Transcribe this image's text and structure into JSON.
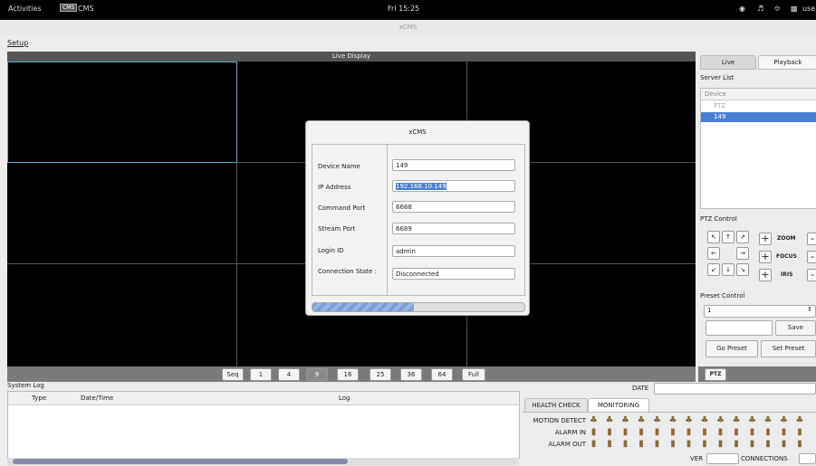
{
  "topbar": {
    "activities": "Activities",
    "app_icon": "CMS",
    "app_name": "CMS",
    "clock": "Fri 15:25",
    "user": "use"
  },
  "window": {
    "title": "xCMS"
  },
  "menu": {
    "setup": "Setup"
  },
  "live": {
    "header": "Live Display",
    "layout_buttons": [
      "Seq",
      "1",
      "4",
      "9",
      "16",
      "25",
      "36",
      "64",
      "Full"
    ],
    "selected_layout": "9"
  },
  "right_panel": {
    "tabs": {
      "live": "Live",
      "playback": "Playback"
    },
    "server_list_label": "Server List",
    "device_header": "Device",
    "devices": [
      "PTZ",
      "149"
    ],
    "selected_device": "149",
    "ptz_control_label": "PTZ Control",
    "ptz_arrows": [
      "↖",
      "↑",
      "↗",
      "←",
      "",
      "→",
      "↙",
      "↓",
      "↘"
    ],
    "ptz_params": [
      {
        "label": "ZOOM"
      },
      {
        "label": "FOCUS"
      },
      {
        "label": "IRIS"
      }
    ],
    "preset_control_label": "Preset Control",
    "preset_value": "1",
    "preset_name_value": "",
    "save": "Save",
    "go_preset": "Go Preset",
    "set_preset": "Set Preset",
    "ptz_button": "PTZ"
  },
  "system_log": {
    "title": "System Log",
    "columns": [
      "Type",
      "Date/Time",
      "Log"
    ]
  },
  "monitor": {
    "date_label": "DATE",
    "tabs": [
      "HEALTH CHECK",
      "MONITORING"
    ],
    "active_tab": "MONITORING",
    "rows": [
      "MOTION DETECT",
      "ALARM IN",
      "ALARM OUT"
    ],
    "ver_label": "VER",
    "connections_label": "CONNECTIONS"
  },
  "dialog": {
    "title": "xCMS",
    "fields": [
      {
        "label": "Device Name",
        "value": "149"
      },
      {
        "label": "IP Address",
        "value": "192.168.10.149"
      },
      {
        "label": "Command Port",
        "value": "6688"
      },
      {
        "label": "Stream Port",
        "value": "6689"
      },
      {
        "label": "Login ID",
        "value": "admin"
      },
      {
        "label": "Connection State :",
        "value": "Disconnected"
      }
    ],
    "progress": 0.48
  },
  "colors": {
    "selection": "#4a7fd6",
    "cell_border": "#66aacc",
    "icon_brown": "#8a6a3a"
  }
}
